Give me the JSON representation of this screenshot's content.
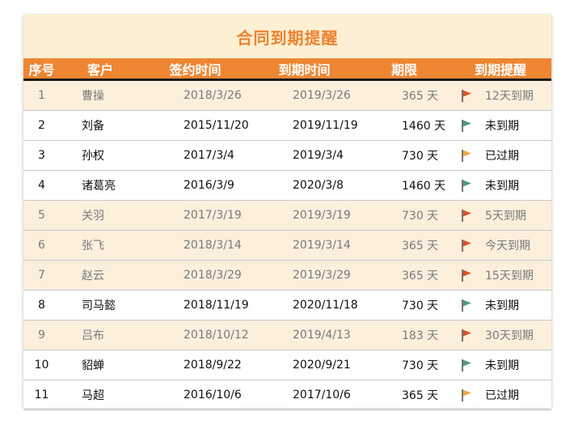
{
  "title": "合同到期提醒",
  "headers": {
    "num": "序号",
    "customer": "客户",
    "sign_date": "签约时间",
    "due_date": "到期时间",
    "term": "期限",
    "reminder": "到期提醒"
  },
  "colors": {
    "flag_red": "#d9522c",
    "flag_green": "#4f9a7a",
    "flag_yellow": "#e9a94c",
    "header_bg": "#ee8633",
    "title_color": "#ef8230"
  },
  "rows": [
    {
      "num": "1",
      "customer": "曹操",
      "sign": "2018/3/26",
      "due": "2019/3/26",
      "term": "365 天",
      "flag": "red",
      "reminder": "12天到期",
      "highlight": true
    },
    {
      "num": "2",
      "customer": "刘备",
      "sign": "2015/11/20",
      "due": "2019/11/19",
      "term": "1460 天",
      "flag": "green",
      "reminder": "未到期",
      "highlight": false
    },
    {
      "num": "3",
      "customer": "孙权",
      "sign": "2017/3/4",
      "due": "2019/3/4",
      "term": "730 天",
      "flag": "yellow",
      "reminder": "已过期",
      "highlight": false
    },
    {
      "num": "4",
      "customer": "诸葛亮",
      "sign": "2016/3/9",
      "due": "2020/3/8",
      "term": "1460 天",
      "flag": "green",
      "reminder": "未到期",
      "highlight": false
    },
    {
      "num": "5",
      "customer": "关羽",
      "sign": "2017/3/19",
      "due": "2019/3/19",
      "term": "730 天",
      "flag": "red",
      "reminder": "5天到期",
      "highlight": true
    },
    {
      "num": "6",
      "customer": "张飞",
      "sign": "2018/3/14",
      "due": "2019/3/14",
      "term": "365 天",
      "flag": "red",
      "reminder": "今天到期",
      "highlight": true
    },
    {
      "num": "7",
      "customer": "赵云",
      "sign": "2018/3/29",
      "due": "2019/3/29",
      "term": "365 天",
      "flag": "red",
      "reminder": "15天到期",
      "highlight": true
    },
    {
      "num": "8",
      "customer": "司马懿",
      "sign": "2018/11/19",
      "due": "2020/11/18",
      "term": "730 天",
      "flag": "green",
      "reminder": "未到期",
      "highlight": false
    },
    {
      "num": "9",
      "customer": "吕布",
      "sign": "2018/10/12",
      "due": "2019/4/13",
      "term": "183 天",
      "flag": "red",
      "reminder": "30天到期",
      "highlight": true
    },
    {
      "num": "10",
      "customer": "貂蝉",
      "sign": "2018/9/22",
      "due": "2020/9/21",
      "term": "730 天",
      "flag": "green",
      "reminder": "未到期",
      "highlight": false
    },
    {
      "num": "11",
      "customer": "马超",
      "sign": "2016/10/6",
      "due": "2017/10/6",
      "term": "365 天",
      "flag": "yellow",
      "reminder": "已过期",
      "highlight": false
    }
  ]
}
